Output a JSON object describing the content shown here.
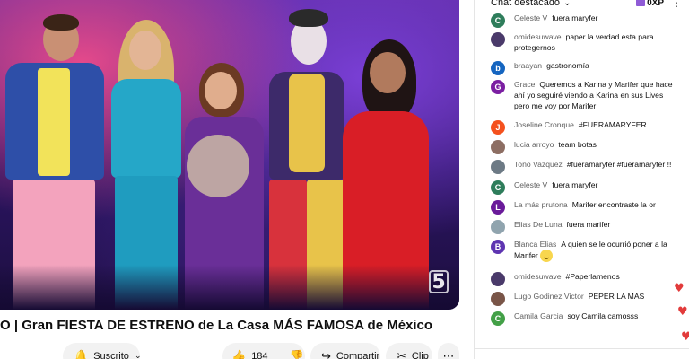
{
  "video": {
    "channel_mark": "5",
    "title": "O | Gran FIESTA DE ESTRENO de La Casa MÁS FAMOSA de México"
  },
  "actions": {
    "subscribe_label": "Suscrito",
    "like_count": "184",
    "share_label": "Compartir",
    "clip_label": "Clip",
    "icons": {
      "bell": "bell-icon",
      "chevron": "chevron-down-icon",
      "like": "thumbs-up-icon",
      "dislike": "thumbs-down-icon",
      "share": "share-icon",
      "clip": "scissors-icon",
      "more": "more-icon"
    }
  },
  "chat": {
    "mode_label": "Chat destacado",
    "points_label": "0XP",
    "messages": [
      {
        "initial": "C",
        "color": "#2e7d5b",
        "author": "Celeste V",
        "text": "fuera maryfer"
      },
      {
        "initial": "",
        "color": "#4a3a6a",
        "author": "omidesuwave",
        "text": "paper la verdad esta para protegernos"
      },
      {
        "initial": "b",
        "color": "#1565c0",
        "author": "braayan",
        "text": "gastronomía"
      },
      {
        "initial": "G",
        "color": "#7b1fa2",
        "author": "Grace",
        "text": "Queremos a Karina y Marifer que hace ahí yo seguiré viendo a Karina en sus Lives pero me voy por Marifer"
      },
      {
        "initial": "J",
        "color": "#f4511e",
        "author": "Joseline Cronque",
        "text": "#FUERAMARYFER"
      },
      {
        "initial": "",
        "color": "#8d6e63",
        "author": "lucia arroyo",
        "text": "team botas"
      },
      {
        "initial": "",
        "color": "#6d7a85",
        "author": "Toño Vazquez",
        "text": "#fueramaryfer #fueramaryfer !!"
      },
      {
        "initial": "C",
        "color": "#2e7d5b",
        "author": "Celeste V",
        "text": "fuera maryfer"
      },
      {
        "initial": "L",
        "color": "#6a1b9a",
        "author": "La más prutona",
        "text": "Marifer encontraste la or"
      },
      {
        "initial": "",
        "color": "#90a4ae",
        "author": "Elias De Luna",
        "text": "fuera marifer"
      },
      {
        "initial": "B",
        "color": "#5e35b1",
        "author": "Blanca Elias",
        "text": "A quien se le ocurrió poner a la Marifer",
        "emoji": true
      },
      {
        "initial": "",
        "color": "#4a3a6a",
        "author": "omidesuwave",
        "text": "#Paperlamenos"
      },
      {
        "initial": "",
        "color": "#795548",
        "author": "Lugo Godinez Victor",
        "text": "PEPER LA MAS"
      },
      {
        "initial": "C",
        "color": "#43a047",
        "author": "Camila Garcia",
        "text": "soy Camila camosss"
      }
    ]
  }
}
